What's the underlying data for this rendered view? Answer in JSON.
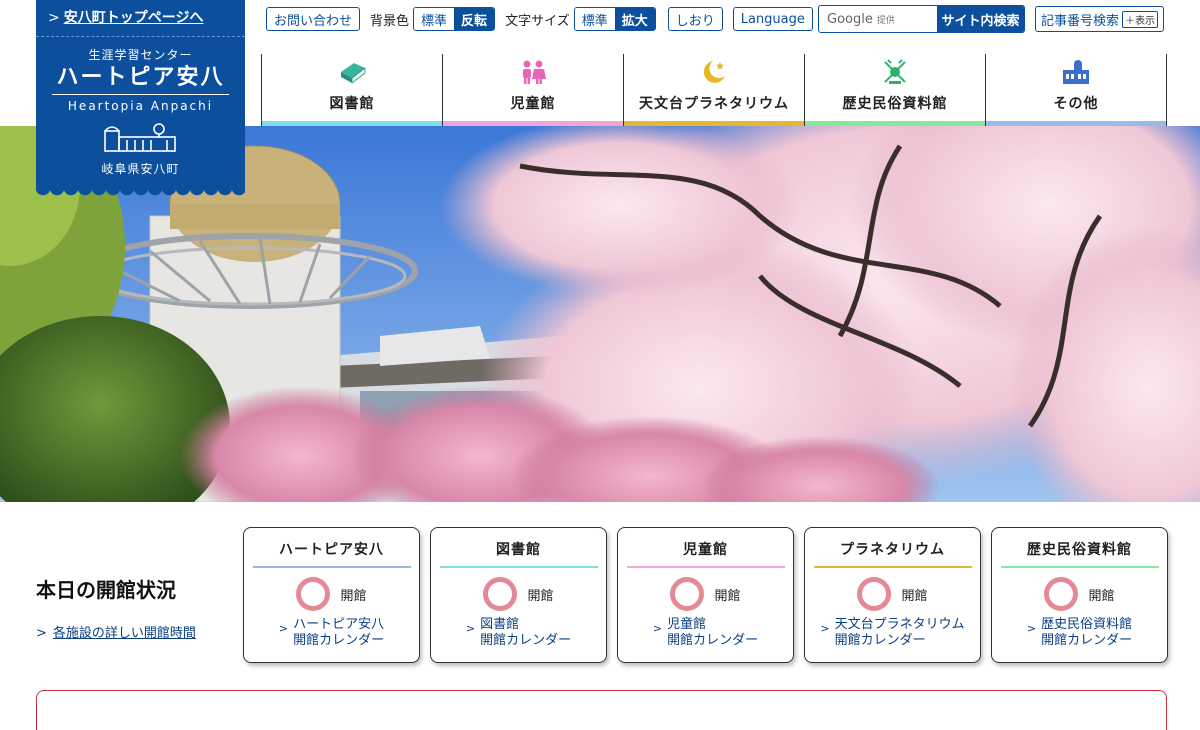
{
  "logo": {
    "top_link": "安八町トップページへ",
    "subtitle": "生涯学習センター",
    "name": "ハートピア安八",
    "roman": "Heartopia Anpachi",
    "prefecture": "岐阜県安八町"
  },
  "utility": {
    "contact": "お問い合わせ",
    "bg_label": "背景色",
    "bg_standard": "標準",
    "bg_invert": "反転",
    "text_label": "文字サイズ",
    "text_standard": "標準",
    "text_large": "拡大",
    "bookmark": "しおり",
    "language": "Language",
    "search_google": "Google",
    "search_provided": "提供",
    "search_button": "サイト内検索",
    "article_search": "記事番号検索",
    "article_show": "＋表示"
  },
  "nav": [
    {
      "label": "図書館",
      "icon": "book-icon",
      "color": "#7fe0e4"
    },
    {
      "label": "児童館",
      "icon": "children-icon",
      "color": "#f2a6d4"
    },
    {
      "label": "天文台プラネタリウム",
      "icon": "moon-star-icon",
      "color": "#e2b834"
    },
    {
      "label": "歴史民俗資料館",
      "icon": "folk-museum-icon",
      "color": "#86e89c"
    },
    {
      "label": "その他",
      "icon": "building-icon",
      "color": "#9abbe8"
    }
  ],
  "status": {
    "title": "本日の開館状況",
    "detail_link": "各施設の詳しい開館時間",
    "cards": [
      {
        "title": "ハートピア安八",
        "status": "開館",
        "cal_line1": "ハートピア安八",
        "cal_line2": "開館カレンダー",
        "color": "#9abbe8"
      },
      {
        "title": "図書館",
        "status": "開館",
        "cal_line1": "図書館",
        "cal_line2": "開館カレンダー",
        "color": "#7fe0e4"
      },
      {
        "title": "児童館",
        "status": "開館",
        "cal_line1": "児童館",
        "cal_line2": "開館カレンダー",
        "color": "#f2a6d4"
      },
      {
        "title": "プラネタリウム",
        "status": "開館",
        "cal_line1": "天文台プラネタリウム",
        "cal_line2": "開館カレンダー",
        "color": "#e2b834"
      },
      {
        "title": "歴史民俗資料館",
        "status": "開館",
        "cal_line1": "歴史民俗資料館",
        "cal_line2": "開館カレンダー",
        "color": "#86e89c"
      }
    ]
  },
  "colors": {
    "brand": "#0c4f9c",
    "open_ring": "#e48a96",
    "notice_border": "#c8323b"
  }
}
